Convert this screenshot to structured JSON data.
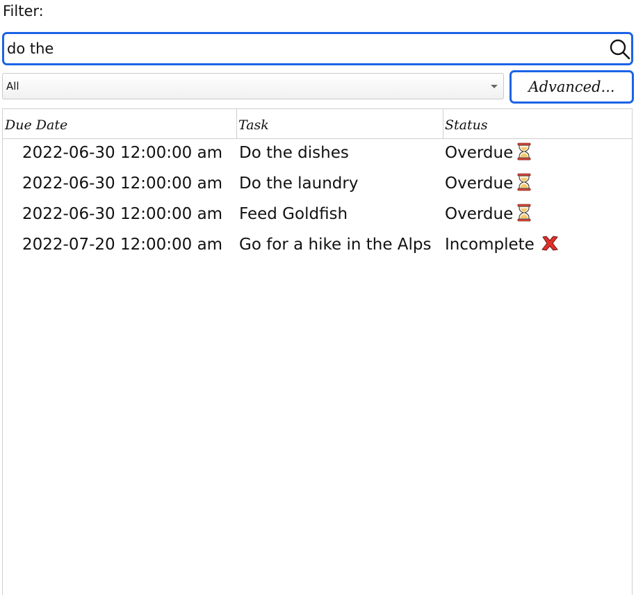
{
  "filter": {
    "label": "Filter:",
    "search_value": "do the",
    "search_icon": "search-icon"
  },
  "category_select": {
    "selected": "All",
    "icon": "chevron-down-icon"
  },
  "advanced_button": {
    "label": "Advanced..."
  },
  "table": {
    "columns": [
      "Due Date",
      "Task",
      "Status"
    ],
    "rows": [
      {
        "due": "2022-06-30 12:00:00 am",
        "task": "Do the dishes",
        "status": "Overdue",
        "icon": "hourglass-icon"
      },
      {
        "due": "2022-06-30 12:00:00 am",
        "task": "Do the laundry",
        "status": "Overdue",
        "icon": "hourglass-icon"
      },
      {
        "due": "2022-06-30 12:00:00 am",
        "task": "Feed Goldfish",
        "status": "Overdue",
        "icon": "hourglass-icon"
      },
      {
        "due": "2022-07-20 12:00:00 am",
        "task": "Go for a hike in the Alps",
        "status": "Incomplete",
        "icon": "cross-mark-icon"
      }
    ]
  },
  "colors": {
    "focus_border": "#1b63e6",
    "hourglass_frame": "#e0483a",
    "hourglass_sand": "#f5c76b",
    "cross_mark": "#e0302a"
  }
}
